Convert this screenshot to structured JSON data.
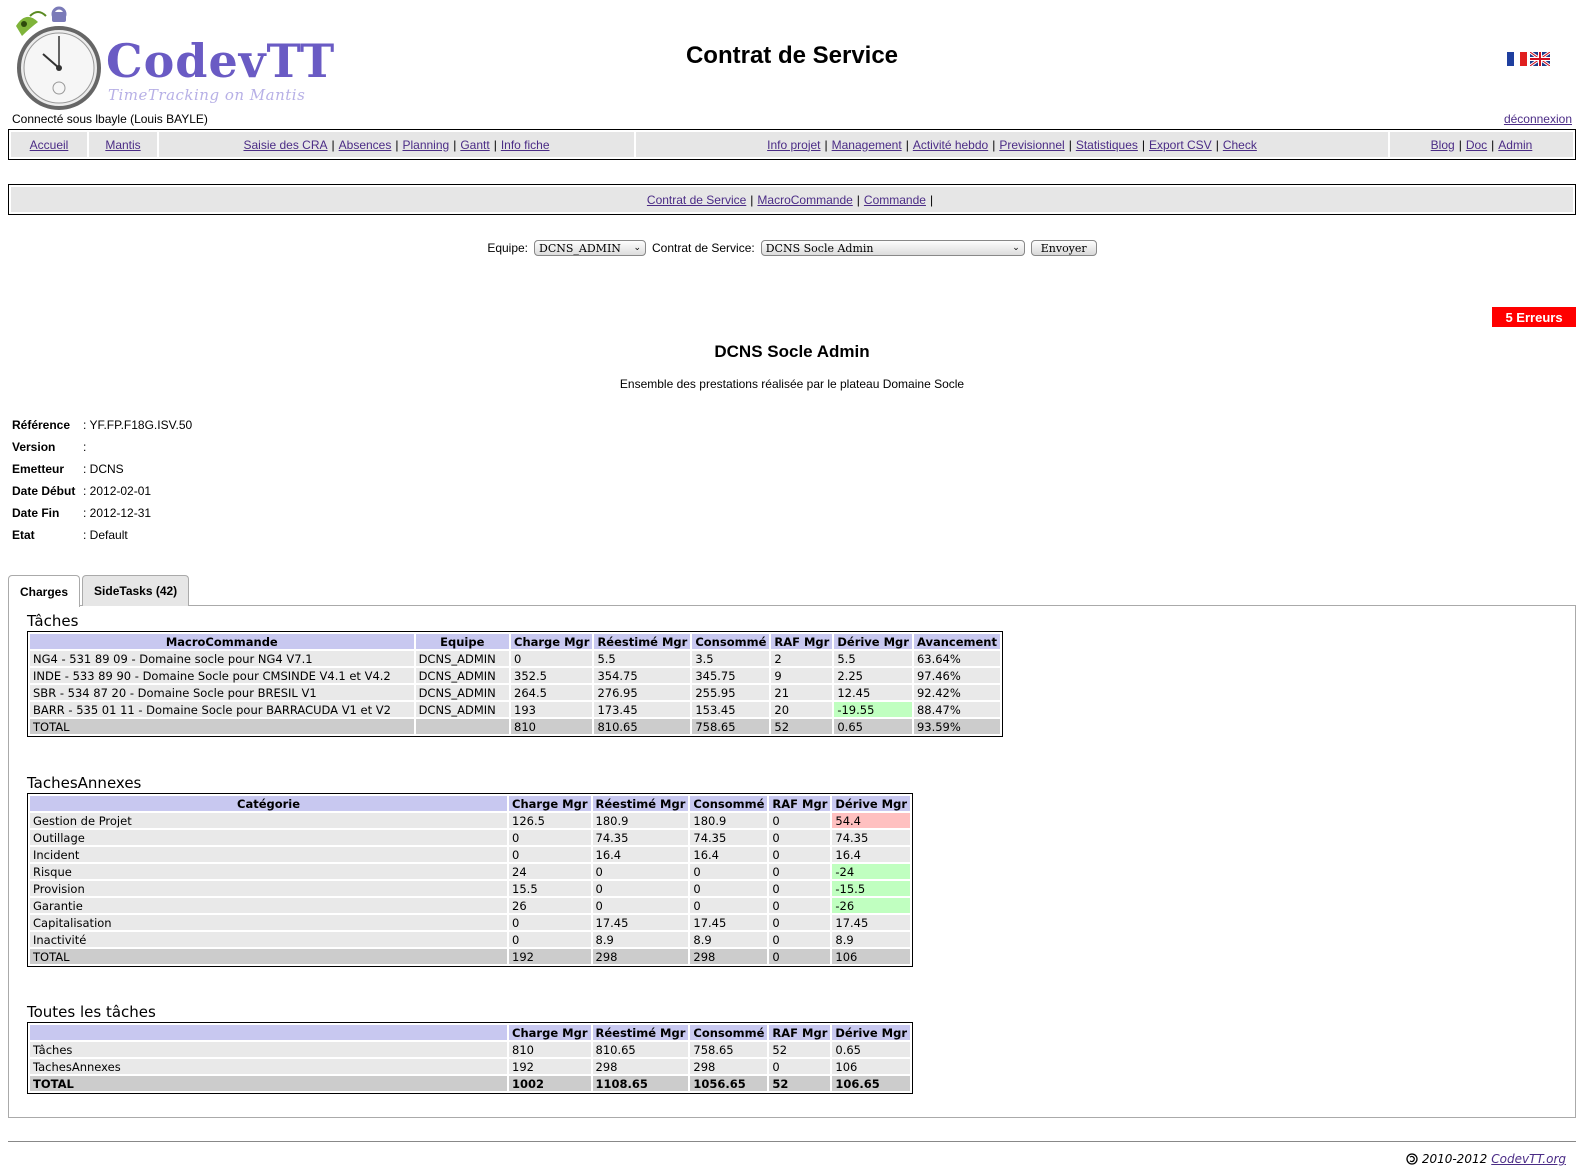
{
  "header": {
    "logo_text": "CodevTT",
    "logo_subtitle": "TimeTracking on Mantis",
    "page_title": "Contrat de Service",
    "user_line": "Connecté sous lbayle (Louis BAYLE)",
    "logout_label": "déconnexion"
  },
  "menu": {
    "home": "Accueil",
    "mantis": "Mantis",
    "group1": [
      "Saisie des CRA",
      "Absences",
      "Planning",
      "Gantt",
      "Info fiche"
    ],
    "group2": [
      "Info projet",
      "Management",
      "Activité hebdo",
      "Previsionnel",
      "Statistiques",
      "Export CSV",
      "Check"
    ],
    "group3": [
      "Blog",
      "Doc",
      "Admin"
    ]
  },
  "submenu": [
    "Contrat de Service",
    "MacroCommande",
    "Commande"
  ],
  "form": {
    "team_label": "Equipe:",
    "team_value": "DCNS_ADMIN",
    "contract_label": "Contrat de Service:",
    "contract_value": "DCNS Socle Admin",
    "submit_label": "Envoyer"
  },
  "errors_badge": "5 Erreurs",
  "contract": {
    "name": "DCNS Socle Admin",
    "description": "Ensemble des prestations réalisée par le plateau Domaine Socle",
    "info": [
      {
        "key": "Référence",
        "value": ": YF.FP.F18G.ISV.50"
      },
      {
        "key": "Version",
        "value": ":"
      },
      {
        "key": "Emetteur",
        "value": ": DCNS"
      },
      {
        "key": "Date Début",
        "value": ": 2012-02-01"
      },
      {
        "key": "Date Fin",
        "value": ": 2012-12-31"
      },
      {
        "key": "Etat",
        "value": ": Default"
      }
    ]
  },
  "tabs": [
    "Charges",
    "SideTasks (42)"
  ],
  "taches": {
    "title": "Tâches",
    "headers": [
      "MacroCommande",
      "Equipe",
      "Charge Mgr",
      "Réestimé Mgr",
      "Consommé",
      "RAF Mgr",
      "Dérive Mgr",
      "Avancement"
    ],
    "rows": [
      [
        "NG4 - 531 89 09 - Domaine socle pour NG4 V7.1",
        "DCNS_ADMIN",
        "0",
        "5.5",
        "3.5",
        "2",
        "5.5",
        "63.64%"
      ],
      [
        "INDE - 533 89 90 - Domaine Socle pour CMSINDE V4.1 et V4.2",
        "DCNS_ADMIN",
        "352.5",
        "354.75",
        "345.75",
        "9",
        "2.25",
        "97.46%"
      ],
      [
        "SBR - 534 87 20 - Domaine Socle pour BRESIL V1",
        "DCNS_ADMIN",
        "264.5",
        "276.95",
        "255.95",
        "21",
        "12.45",
        "92.42%"
      ],
      [
        "BARR - 535 01 11 - Domaine Socle pour BARRACUDA V1 et V2",
        "DCNS_ADMIN",
        "193",
        "173.45",
        "153.45",
        "20",
        "-19.55",
        "88.47%"
      ]
    ],
    "total": [
      "TOTAL",
      "",
      "810",
      "810.65",
      "758.65",
      "52",
      "0.65",
      "93.59%"
    ]
  },
  "annexes": {
    "title": "TachesAnnexes",
    "headers": [
      "Catégorie",
      "Charge Mgr",
      "Réestimé Mgr",
      "Consommé",
      "RAF Mgr",
      "Dérive Mgr"
    ],
    "rows": [
      [
        "Gestion de Projet",
        "126.5",
        "180.9",
        "180.9",
        "0",
        "54.4"
      ],
      [
        "Outillage",
        "0",
        "74.35",
        "74.35",
        "0",
        "74.35"
      ],
      [
        "Incident",
        "0",
        "16.4",
        "16.4",
        "0",
        "16.4"
      ],
      [
        "Risque",
        "24",
        "0",
        "0",
        "0",
        "-24"
      ],
      [
        "Provision",
        "15.5",
        "0",
        "0",
        "0",
        "-15.5"
      ],
      [
        "Garantie",
        "26",
        "0",
        "0",
        "0",
        "-26"
      ],
      [
        "Capitalisation",
        "0",
        "17.45",
        "17.45",
        "0",
        "17.45"
      ],
      [
        "Inactivité",
        "0",
        "8.9",
        "8.9",
        "0",
        "8.9"
      ]
    ],
    "total": [
      "TOTAL",
      "192",
      "298",
      "298",
      "0",
      "106"
    ]
  },
  "toutes": {
    "title": "Toutes les tâches",
    "headers": [
      "",
      "Charge Mgr",
      "Réestimé Mgr",
      "Consommé",
      "RAF Mgr",
      "Dérive Mgr"
    ],
    "rows": [
      [
        "Tâches",
        "810",
        "810.65",
        "758.65",
        "52",
        "0.65"
      ],
      [
        "TachesAnnexes",
        "192",
        "298",
        "298",
        "0",
        "106"
      ]
    ],
    "total": [
      "TOTAL",
      "1002",
      "1108.65",
      "1056.65",
      "52",
      "106.65"
    ]
  },
  "footer": {
    "years": "2010-2012",
    "link": "CodevTT.org"
  },
  "colors": {
    "header_bg": "#c8c8f0",
    "row_bg": "#e9e9e9",
    "total_bg": "#cccccc",
    "negative_derive": "#c0ffc0",
    "positive_derive": "#ffc0c0",
    "error_badge": "#ff0000",
    "logo": "#6a5bc4",
    "link": "#4b2c86"
  }
}
